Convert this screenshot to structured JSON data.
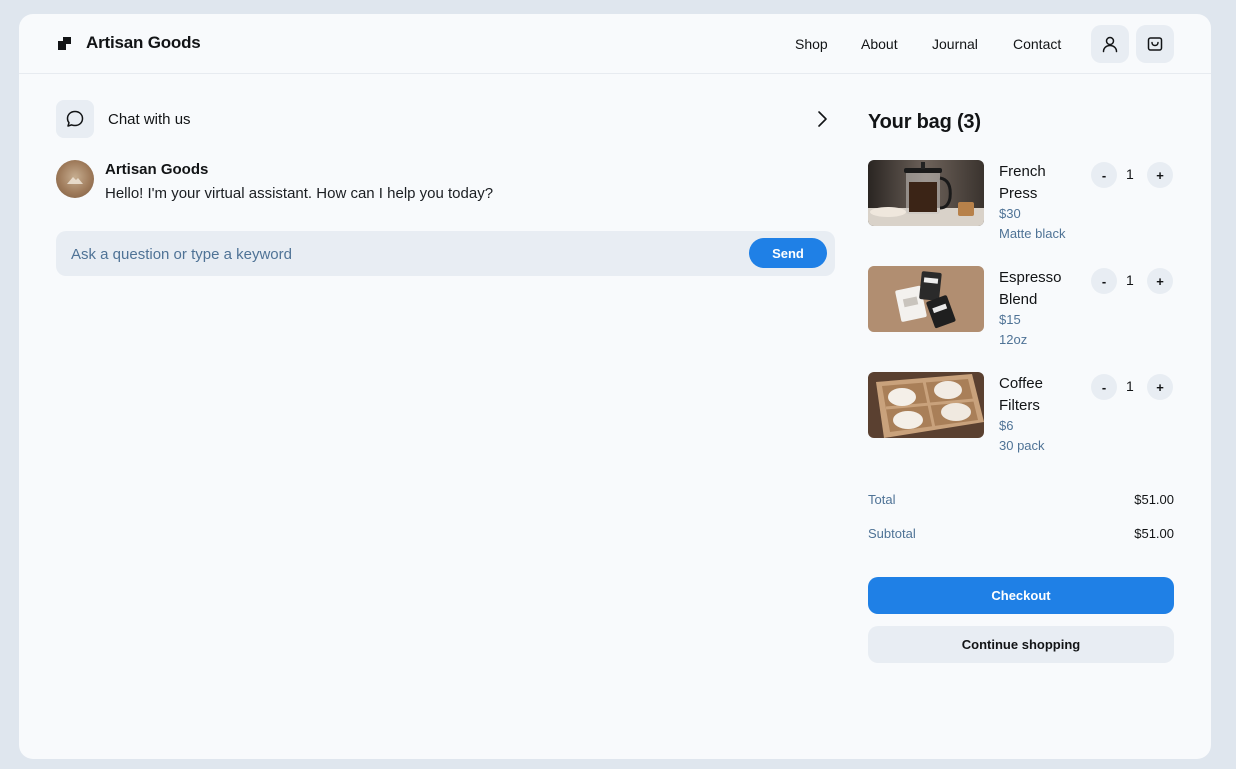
{
  "header": {
    "brand": "Artisan Goods",
    "nav": [
      "Shop",
      "About",
      "Journal",
      "Contact"
    ]
  },
  "chat": {
    "title": "Chat with us",
    "sender": "Artisan Goods",
    "message": "Hello! I'm your virtual assistant. How can I help you today?",
    "input_placeholder": "Ask a question or type a keyword",
    "input_value": "",
    "send_label": "Send"
  },
  "bag": {
    "title": "Your bag (3)",
    "items": [
      {
        "name": "French Press",
        "price": "$30",
        "variant": "Matte black",
        "qty": "1"
      },
      {
        "name": "Espresso Blend",
        "price": "$15",
        "variant": "12oz",
        "qty": "1"
      },
      {
        "name": "Coffee Filters",
        "price": "$6",
        "variant": "30 pack",
        "qty": "1"
      }
    ],
    "qty_minus": "-",
    "qty_plus": "+",
    "total_label": "Total",
    "total_value": "$51.00",
    "subtotal_label": "Subtotal",
    "subtotal_value": "$51.00",
    "checkout_label": "Checkout",
    "continue_label": "Continue shopping"
  },
  "colors": {
    "accent": "#1f80e6",
    "muted_text": "#4f7396",
    "surface": "#e8edf3",
    "page_bg": "#f8fafc"
  },
  "icons": {
    "logo": "logo-mark-icon",
    "account": "user-icon",
    "cart": "shopping-bag-icon",
    "chat": "chat-bubble-icon",
    "expand": "chevron-right-icon"
  }
}
